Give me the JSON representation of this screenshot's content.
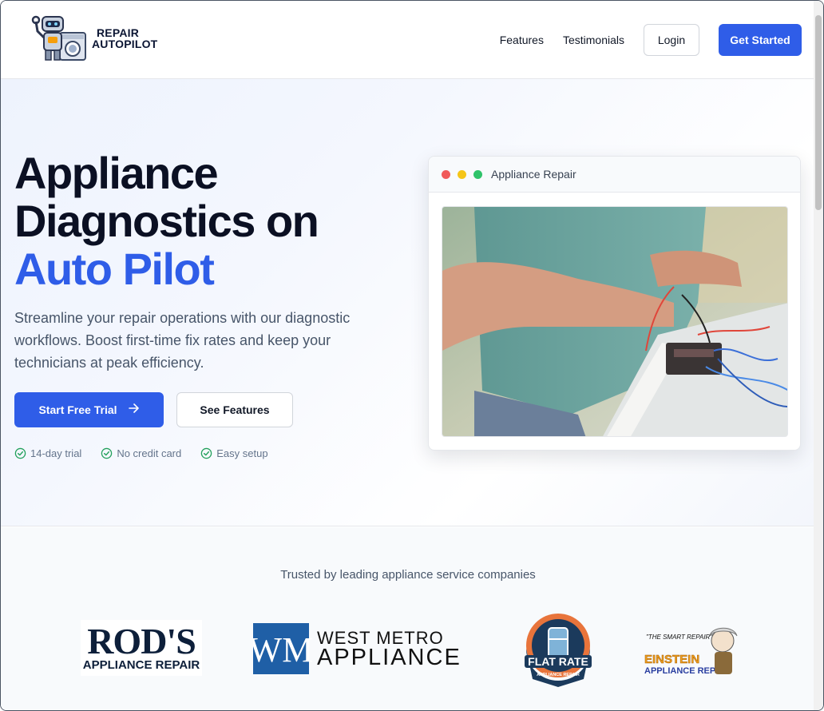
{
  "header": {
    "logo_line1": "REPAIR",
    "logo_line2": "AUTOPILOT",
    "nav": [
      "Features",
      "Testimonials"
    ],
    "login": "Login",
    "get_started": "Get Started"
  },
  "hero": {
    "headline_line1": "Appliance",
    "headline_line2": "Diagnostics on",
    "headline_accent": "Auto Pilot",
    "subtitle": "Streamline your repair operations with our diagnostic workflows. Boost first-time fix rates and keep your technicians at peak efficiency.",
    "cta_primary": "Start Free Trial",
    "cta_secondary": "See Features",
    "perks": [
      "14-day trial",
      "No credit card",
      "Easy setup"
    ],
    "window_title": "Appliance Repair"
  },
  "trusted": {
    "title": "Trusted by leading appliance service companies",
    "brands": [
      {
        "name": "ROD'S",
        "tagline": "APPLIANCE REPAIR"
      },
      {
        "name": "WEST METRO",
        "tagline": "APPLIANCE"
      },
      {
        "name": "FLAT RATE",
        "tagline": "APPLIANCE REPAIR"
      },
      {
        "name": "EINSTEIN",
        "tagline": "APPLIANCE REPAIR",
        "slogan": "\"THE SMART REPAIR\""
      }
    ]
  },
  "colors": {
    "accent": "#2f5de8",
    "dark": "#0b1023",
    "check": "#22a05b"
  }
}
